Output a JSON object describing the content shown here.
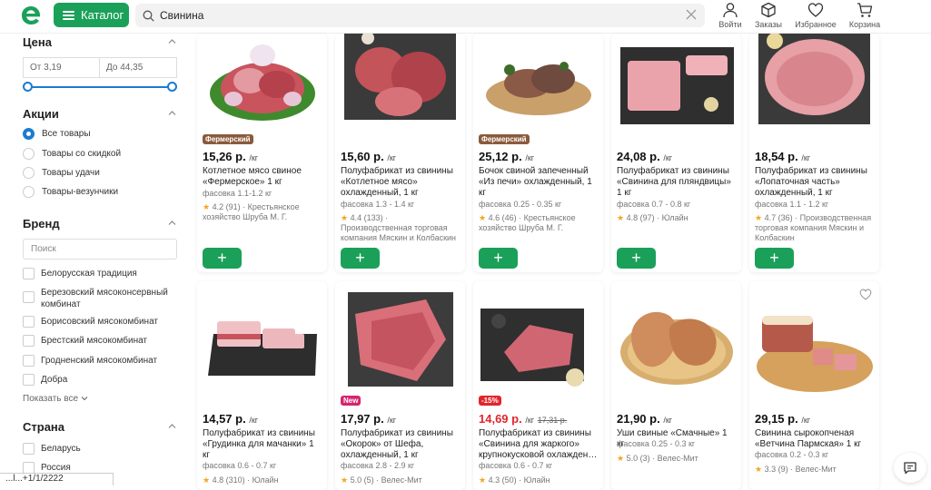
{
  "header": {
    "catalog_label": "Каталог",
    "search_value": "Свинина",
    "nav": [
      {
        "label": "Войти",
        "icon": "user-icon"
      },
      {
        "label": "Заказы",
        "icon": "box-icon"
      },
      {
        "label": "Избранное",
        "icon": "heart-icon"
      },
      {
        "label": "Корзина",
        "icon": "cart-icon"
      }
    ]
  },
  "sidebar": {
    "price": {
      "title": "Цена",
      "from": "От 3,19",
      "to": "До 44,35"
    },
    "promo": {
      "title": "Акции",
      "options": [
        "Все товары",
        "Товары со скидкой",
        "Товары удачи",
        "Товары-везунчики"
      ],
      "selected": "Все товары"
    },
    "brand": {
      "title": "Бренд",
      "search_placeholder": "Поиск",
      "items": [
        "Белорусская традиция",
        "Березовский мясоконсервный комбинат",
        "Борисовский мясокомбинат",
        "Брестский мясокомбинат",
        "Гродненский мясокомбинат",
        "Добра"
      ],
      "show_all": "Показать все"
    },
    "country": {
      "title": "Страна",
      "items": [
        "Беларусь",
        "Россия"
      ]
    },
    "bottom_bar": "...l...+1/1/2222"
  },
  "products": [
    {
      "badge": "Фермерский",
      "price": "15,26 р.",
      "unit": "/кг",
      "title": "Котлетное мясо свиное «Фермерское» 1 кг",
      "weight": "фасовка 1.1-1.2 кг",
      "rating": "4.2 (91)",
      "seller": "Крестьянское хозяйство Шруба М. Г."
    },
    {
      "badge": "",
      "price": "15,60 р.",
      "unit": "/кг",
      "title": "Полуфабрикат из свинины «Котлетное мясо» охлажденный, 1 кг",
      "weight": "фасовка 1.3 - 1.4 кг",
      "rating": "4.4 (133)",
      "seller": "Производственная торговая компания Мяскин и Колбаскин"
    },
    {
      "badge": "Фермерский",
      "price": "25,12 р.",
      "unit": "/кг",
      "title": "Бочок свиной запеченный «Из печи» охлажденный, 1 кг",
      "weight": "фасовка 0.25 - 0.35 кг",
      "rating": "4.6 (46)",
      "seller": "Крестьянское хозяйство Шруба М. Г."
    },
    {
      "badge": "",
      "price": "24,08 р.",
      "unit": "/кг",
      "title": "Полуфабрикат из свинины «Свинина для пляндвицы» 1 кг",
      "weight": "фасовка 0.7 - 0.8 кг",
      "rating": "4.8 (97)",
      "seller": "Юлайн"
    },
    {
      "badge": "",
      "price": "18,54 р.",
      "unit": "/кг",
      "title": "Полуфабрикат из свинины «Лопаточная часть» охлажденный, 1 кг",
      "weight": "фасовка 1.1 - 1.2 кг",
      "rating": "4.7 (36)",
      "seller": "Производственная торговая компания Мяскин и Колбаскин"
    },
    {
      "badge": "",
      "price": "14,57 р.",
      "unit": "/кг",
      "title": "Полуфабрикат из свинины «Грудинка для мачанки» 1 кг",
      "weight": "фасовка 0.6 - 0.7 кг",
      "rating": "4.8 (310)",
      "seller": "Юлайн"
    },
    {
      "badge": "New",
      "price": "17,97 р.",
      "unit": "/кг",
      "title": "Полуфабрикат из свинины «Окорок» от Шефа, охлажденный, 1 кг",
      "weight": "фасовка 2.8 - 2.9 кг",
      "rating": "5.0 (5)",
      "seller": "Велес-Мит"
    },
    {
      "badge": "-15%",
      "price": "14,69 р.",
      "unit": "/кг",
      "old_price": "17,31 р.",
      "title": "Полуфабрикат из свинины «Свинина для жаркого» крупнокусковой охлажден…",
      "weight": "фасовка 0.6 - 0.7 кг",
      "rating": "4.3 (50)",
      "seller": "Юлайн"
    },
    {
      "badge": "",
      "price": "21,90 р.",
      "unit": "/кг",
      "title": "Уши свиные «Смачные» 1 кг",
      "weight": "фасовка 0.25 - 0.3 кг",
      "rating": "5.0 (3)",
      "seller": "Велес-Мит"
    },
    {
      "badge": "",
      "price": "29,15 р.",
      "unit": "/кг",
      "title": "Свинина сырокопченая «Ветчина Пармская» 1 кг",
      "weight": "фасовка 0.2 - 0.3 кг",
      "rating": "3.3 (9)",
      "seller": "Велес-Мит"
    }
  ],
  "colors": {
    "accent": "#1ba05a",
    "link": "#1c7ad2",
    "farm_badge": "#8a5a3c",
    "new_badge": "#d6246e",
    "sale": "#e0262b"
  }
}
